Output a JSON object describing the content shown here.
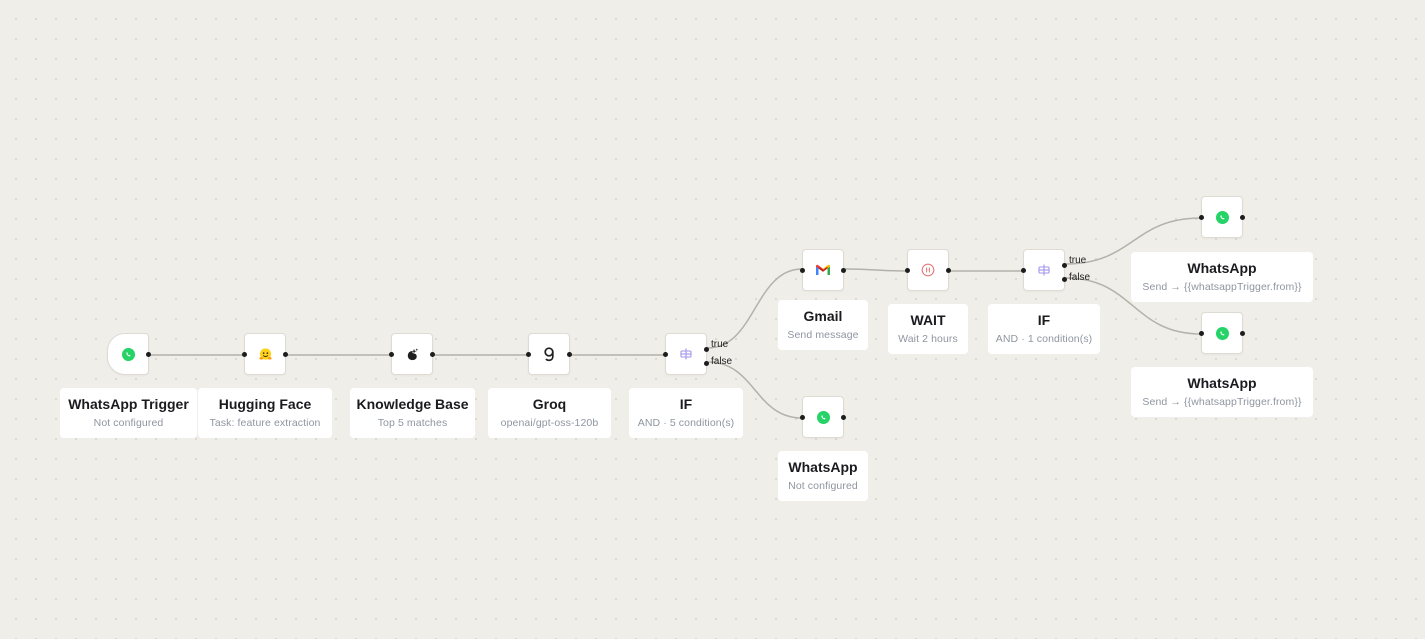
{
  "accent": {
    "whatsapp": "#25d366",
    "if": "#8f7ee0",
    "wait": "#e87979",
    "edge": "#b4b1ab"
  },
  "nodes": {
    "whatsapp_trigger": {
      "icon": "whatsapp-icon",
      "title": "WhatsApp Trigger",
      "subtitle": "Not configured"
    },
    "hugging_face": {
      "icon": "hugging-face-icon",
      "title": "Hugging Face",
      "subtitle": "Task: feature extraction"
    },
    "knowledge_base": {
      "icon": "knowledge-base-icon",
      "title": "Knowledge Base",
      "subtitle": "Top 5 matches"
    },
    "groq": {
      "icon": "groq-icon",
      "title": "Groq",
      "subtitle": "openai/gpt-oss-120b"
    },
    "if_1": {
      "icon": "if-icon",
      "title": "IF",
      "subtitle": "AND · 5 condition(s)",
      "true_label": "true",
      "false_label": "false"
    },
    "gmail": {
      "icon": "gmail-icon",
      "title": "Gmail",
      "subtitle": "Send message"
    },
    "whatsapp_1": {
      "icon": "whatsapp-icon",
      "title": "WhatsApp",
      "subtitle": "Not configured"
    },
    "wait": {
      "icon": "pause-icon",
      "title": "WAIT",
      "subtitle": "Wait 2 hours"
    },
    "if_2": {
      "icon": "if-icon",
      "title": "IF",
      "subtitle": "AND · 1 condition(s)",
      "true_label": "true",
      "false_label": "false"
    },
    "whatsapp_2": {
      "icon": "whatsapp-icon",
      "title": "WhatsApp",
      "subtitle": "Send → {{whatsappTrigger.from}}"
    },
    "whatsapp_3": {
      "icon": "whatsapp-icon",
      "title": "WhatsApp",
      "subtitle": "Send → {{whatsappTrigger.from}}"
    }
  }
}
